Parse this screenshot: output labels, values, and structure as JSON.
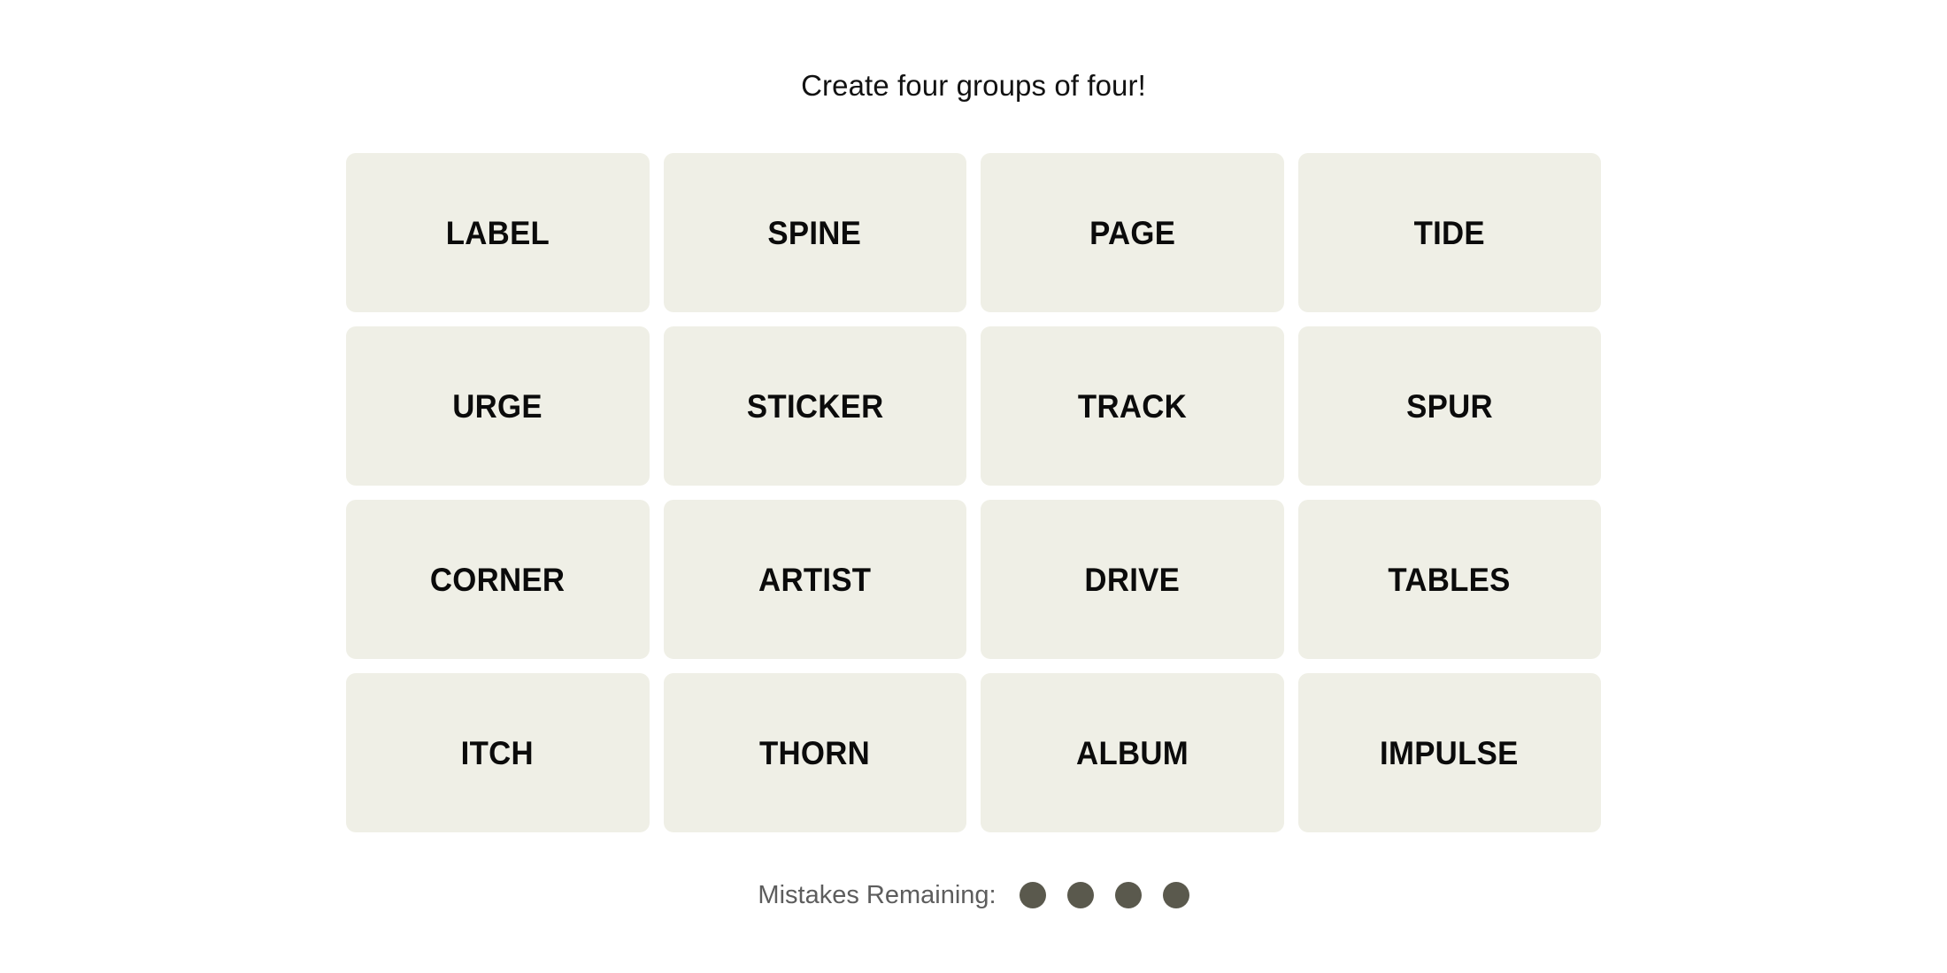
{
  "header": {
    "instruction": "Create four groups of four!"
  },
  "board": {
    "rows": [
      {
        "tiles": [
          {
            "word": "LABEL"
          },
          {
            "word": "SPINE"
          },
          {
            "word": "PAGE"
          },
          {
            "word": "TIDE"
          }
        ]
      },
      {
        "tiles": [
          {
            "word": "URGE"
          },
          {
            "word": "STICKER"
          },
          {
            "word": "TRACK"
          },
          {
            "word": "SPUR"
          }
        ]
      },
      {
        "tiles": [
          {
            "word": "CORNER"
          },
          {
            "word": "ARTIST"
          },
          {
            "word": "DRIVE"
          },
          {
            "word": "TABLES"
          }
        ]
      },
      {
        "tiles": [
          {
            "word": "ITCH"
          },
          {
            "word": "THORN"
          },
          {
            "word": "ALBUM"
          },
          {
            "word": "IMPULSE"
          }
        ]
      }
    ]
  },
  "footer": {
    "mistakes_label": "Mistakes Remaining:",
    "mistakes_count": 4,
    "dots": [
      "dot-1",
      "dot-2",
      "dot-3",
      "dot-4"
    ]
  },
  "colors": {
    "page_background": "#FFFFFF",
    "tile_background": "#EFEFE6",
    "tile_text": "#0B0B0B",
    "instruction_text": "#121212",
    "mistakes_label_text": "#5D5D5D",
    "mistake_dot": "#5A594D"
  }
}
